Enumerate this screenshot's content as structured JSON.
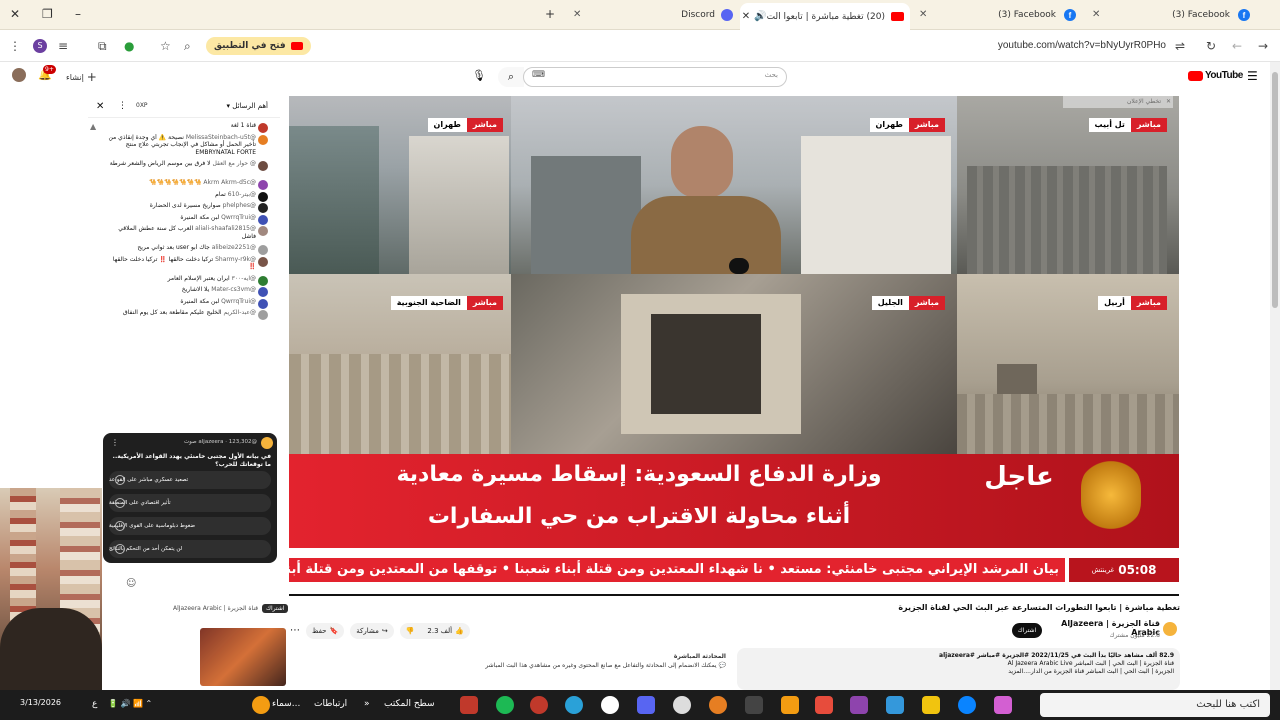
{
  "browser": {
    "tabs": [
      {
        "label": "Discord",
        "icon": "discord-icon"
      },
      {
        "label": "(20) تغطية مباشرة | تابعوا الت",
        "icon": "youtube-icon",
        "active": true
      },
      {
        "label": "(3) Facebook",
        "icon": "facebook-icon"
      },
      {
        "label": "(3) Facebook",
        "icon": "facebook-icon"
      }
    ],
    "new_tab": "+",
    "open_in_app": "فتح في التطبيق",
    "url": "youtube.com/watch?v=bNyUyrR0PHo"
  },
  "youtube": {
    "logo": "YouTube",
    "search_placeholder": "بحث",
    "create_label": "إنشاء",
    "bell_count": "9+"
  },
  "chat": {
    "header": "أهم الرسائل",
    "messages": [
      {
        "author": "",
        "text": "قناة 1 لغة"
      },
      {
        "author": "@MelissaSteinbach-u5t",
        "text": "نصيحة ⚠️ أي وجدة إنقاذي من تأخير الحمل أو مشاكل في الإنجاب تجربتي علاج منتج EMBRYNATAL FORTE"
      },
      {
        "author": "@ حوار مع العقل",
        "text": "لا فرق بين موسم الرياض والشعر شرطة"
      },
      {
        "author": "@Akrm Akrm-d5c",
        "text": "🐪🐪🐪🐪🐪🐪🐪"
      },
      {
        "author": "@بيتر-610",
        "text": "تمام"
      },
      {
        "author": "@phelphes",
        "text": "صواريخ مسيرة لدى الحضارة"
      },
      {
        "author": "@QwrrqTrui",
        "text": "لبن مكة المنيرة"
      },
      {
        "author": "@aliali-shaafali2815",
        "text": "العرب كل سنة عطش الملاقي فاشل"
      },
      {
        "author": "@alibeize2251",
        "text": "جاك أبو user بعد ثواني مريح"
      },
      {
        "author": "@Sharmy-r9k",
        "text": "تركيا دخلت حالقها ‼️ تركيا دخلت حالقها ‼️"
      },
      {
        "author": "@ايه-٣٠٠",
        "text": "ايران يعتبر الإسلام العامر"
      },
      {
        "author": "@Mater-cs3vm",
        "text": "يلا الاشاريخ"
      },
      {
        "author": "@QwrrqTrui",
        "text": "لبن مكة المنيرة"
      },
      {
        "author": "@عبد-الكريم",
        "text": "الخليج عليكم مقاطعة بعد كل يوم النفاق"
      }
    ]
  },
  "poll": {
    "author": "@aljazeera",
    "meta": "123,302 صوت",
    "question": "في بيانه الأول مجتبى خامنئي يهدد القواعد الأمريكية.. ما توقعاتك للحرب؟",
    "options": [
      "تصعيد عسكري مباشر على القواعد",
      "تأثير اقتصادي على المنطقة",
      "ضغوط دبلوماسية على القوى الإقليمية",
      "لن يتمكن أحد من التحكم بالنتائج"
    ]
  },
  "video": {
    "ad_text": "تخطي الإعلان",
    "panels": [
      {
        "loc": "طهران",
        "live": "مباشر"
      },
      {
        "loc": "طهران",
        "live": "مباشر"
      },
      {
        "loc": "تل أبيب",
        "live": "مباشر"
      },
      {
        "loc": "الضاحية الجنوبية",
        "live": "مباشر"
      },
      {
        "loc": "الجليل",
        "live": "مباشر"
      },
      {
        "loc": "أربيل",
        "live": "مباشر"
      }
    ],
    "breaking_label": "عاجل",
    "breaking_line1": "وزارة الدفاع السعودية: إسقاط مسيرة معادية",
    "breaking_line2": "أثناء محاولة الاقتراب من حي السفارات",
    "time": "05:08",
    "time_zone": "غرينتش",
    "ticker": "بيان المرشد الإيراني مجتبى خامنئي: مستعد  •  نا شهداء المعتدين ومن قتلة أبناء شعبنا  •  توقفها من المعتدين ومن قتلة أبناء شعبنا"
  },
  "meta": {
    "title": "تغطية مباشرة | تابعوا التطورات المتسارعة عبر البث الحي لقناة الجزيرة",
    "channel": "قناة الجزيرة | AlJazeera Arabic",
    "subscribers": "22.8 مليون مشترك",
    "subscribe": "اشتراك",
    "likes": "2.3 ألف",
    "share": "مشاركة",
    "save": "حفظ",
    "description_line1": "82.9 ألف مشاهد حاليًا  بدأ البث في 2022/11/25  #الجزيرة #مباشر #aljazeera",
    "description_line2": "قناة الجزيرة | البث الحي | البث المباشر Al Jazeera Arabic Live",
    "description_line3": "الجزيرة | البث الحي | البث المباشر  قناة الجزيرة من الدار....المزيد",
    "chat_replay_label": "المحادثة المباشرة",
    "chat_replay_text": "يمكنك الانضمام إلى المحادثة والتفاعل مع صانع المحتوى وغيره من مشاهدي هذا البث المباشر"
  },
  "taskbar": {
    "search": "اكتب هنا للبحث",
    "desktop": "سطح المكتب",
    "links": "ارتباطات",
    "weather": "سماء...",
    "date": "3/13/2026",
    "lang": "ع"
  }
}
